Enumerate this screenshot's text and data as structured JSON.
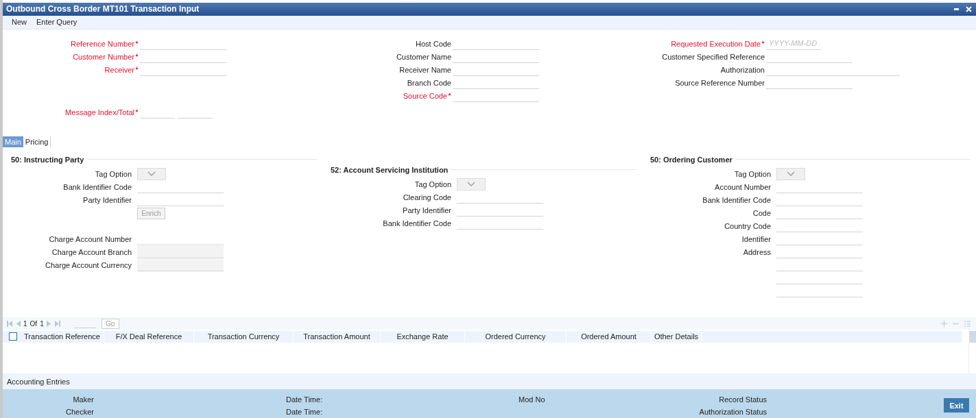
{
  "window": {
    "title": "Outbound Cross Border MT101 Transaction Input"
  },
  "toolbar": [
    "New",
    "Enter Query"
  ],
  "header": [
    [
      {
        "label": "Reference Number",
        "required": true,
        "kind": "field"
      },
      {
        "label": "Customer Number",
        "required": true,
        "kind": "field"
      },
      {
        "label": "Receiver",
        "required": true,
        "kind": "field"
      },
      {
        "label": "Message Index/Total",
        "required": true,
        "kind": "pair"
      }
    ],
    [
      {
        "label": "Host Code",
        "required": false,
        "kind": "field"
      },
      {
        "label": "Customer Name",
        "required": false,
        "kind": "field"
      },
      {
        "label": "Receiver Name",
        "required": false,
        "kind": "field"
      },
      {
        "label": "Branch Code",
        "required": false,
        "kind": "field"
      },
      {
        "label": "Source Code",
        "required": true,
        "kind": "field"
      }
    ],
    [
      {
        "label": "Requested Execution Date",
        "required": true,
        "kind": "date",
        "placeholder": "YYYY-MM-DD"
      },
      {
        "label": "Customer Specified Reference",
        "required": false,
        "kind": "field"
      },
      {
        "label": "Authorization",
        "required": false,
        "kind": "wide"
      },
      {
        "label": "Source Reference Number",
        "required": false,
        "kind": "field"
      }
    ]
  ],
  "tabs": [
    {
      "label": "Main",
      "selected": true
    },
    {
      "label": "Pricing",
      "selected": false
    }
  ],
  "sections": [
    {
      "title": "50: Instructing Party",
      "fields": [
        {
          "label": "Tag Option",
          "kind": "select"
        },
        {
          "label": "Bank Identifier Code",
          "kind": "field"
        },
        {
          "label": "Party Identifier",
          "kind": "field"
        },
        {
          "label": "Enrich",
          "kind": "button"
        }
      ],
      "extra_fields": [
        {
          "label": "Charge Account Number",
          "kind": "field"
        },
        {
          "label": "Charge Account Branch",
          "kind": "readonly"
        },
        {
          "label": "Charge Account Currency",
          "kind": "readonly"
        }
      ]
    },
    {
      "title": "52: Account Servicing Institution",
      "fields": [
        {
          "label": "Tag Option",
          "kind": "select"
        },
        {
          "label": "Clearing Code",
          "kind": "field"
        },
        {
          "label": "Party Identifier",
          "kind": "field"
        },
        {
          "label": "Bank Identifier Code",
          "kind": "field"
        }
      ]
    },
    {
      "title": "50: Ordering Customer",
      "fields": [
        {
          "label": "Tag Option",
          "kind": "select"
        },
        {
          "label": "Account Number",
          "kind": "field"
        },
        {
          "label": "Bank Identifier Code",
          "kind": "field"
        },
        {
          "label": "Code",
          "kind": "field"
        },
        {
          "label": "Country Code",
          "kind": "field"
        },
        {
          "label": "Identifier",
          "kind": "field"
        },
        {
          "label": "Address",
          "kind": "address"
        }
      ]
    }
  ],
  "grid": {
    "page": "1",
    "of": "Of",
    "total": "1",
    "go": "Go",
    "checked": false,
    "columns": [
      "Transaction Reference",
      "F/X Deal Reference",
      "Transaction Currency",
      "Transaction Amount",
      "Exchange Rate",
      "Ordered Currency",
      "Ordered Amount",
      "Other Details"
    ]
  },
  "accounting_entries": "Accounting Entries",
  "footer": {
    "left": [
      "Maker",
      "Checker"
    ],
    "date": [
      "Date Time:",
      "Date Time:"
    ],
    "mod": "Mod No",
    "status": [
      "Record Status",
      "Authorization Status"
    ],
    "exit": "Exit"
  }
}
